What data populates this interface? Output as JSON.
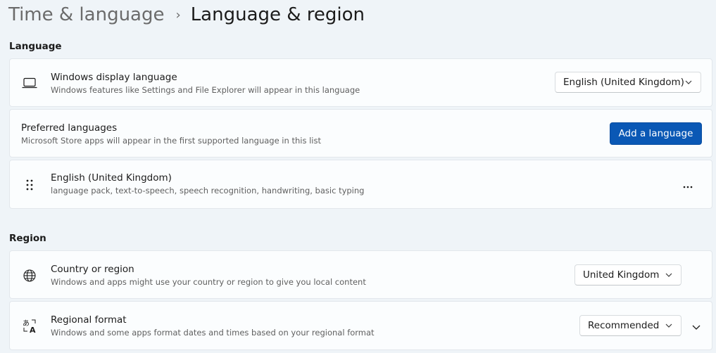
{
  "breadcrumb": {
    "parent": "Time & language",
    "separator": "›",
    "current": "Language & region"
  },
  "language_section": {
    "header": "Language",
    "display_language": {
      "icon": "laptop-icon",
      "title": "Windows display language",
      "description": "Windows features like Settings and File Explorer will appear in this language",
      "selected": "English (United Kingdom)"
    },
    "preferred_languages": {
      "title": "Preferred languages",
      "description": "Microsoft Store apps will appear in the first supported language in this list",
      "add_button": "Add a language"
    },
    "languages": [
      {
        "icon": "drag-handle-icon",
        "name": "English (United Kingdom)",
        "features": "language pack, text-to-speech, speech recognition, handwriting, basic typing",
        "more": "..."
      }
    ]
  },
  "region_section": {
    "header": "Region",
    "country": {
      "icon": "globe-icon",
      "title": "Country or region",
      "description": "Windows and apps might use your country or region to give you local content",
      "selected": "United Kingdom"
    },
    "regional_format": {
      "icon": "regional-format-icon",
      "title": "Regional format",
      "description": "Windows and some apps format dates and times based on your regional format",
      "selected": "Recommended"
    }
  },
  "colors": {
    "background": "#eff4f8",
    "card": "#fbfdfe",
    "accent": "#0a58b5"
  }
}
